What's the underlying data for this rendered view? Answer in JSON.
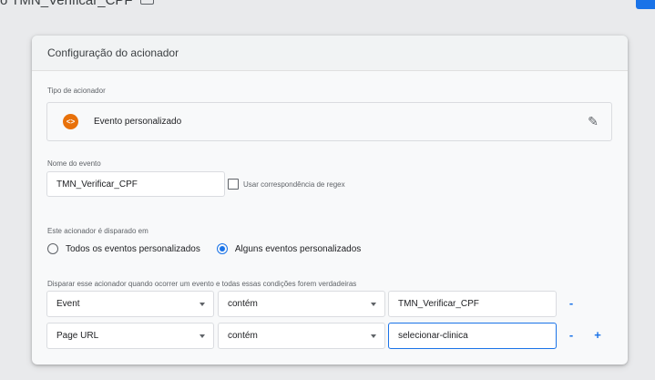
{
  "topbar": {
    "breadcrumb": "o TMN_Verificar_CPF"
  },
  "card": {
    "title": "Configuração do acionador",
    "trigger_type_label": "Tipo de acionador",
    "trigger_type": {
      "icon": "custom-event-icon",
      "icon_glyph": "<>",
      "name": "Evento personalizado",
      "color": "#e8710a"
    },
    "event_name_label": "Nome do evento",
    "event_name_value": "TMN_Verificar_CPF",
    "regex_label": "Usar correspondência de regex",
    "fires_on_label": "Este acionador é disparado em",
    "fires_on_options": [
      {
        "label": "Todos os eventos personalizados",
        "selected": false
      },
      {
        "label": "Alguns eventos personalizados",
        "selected": true
      }
    ],
    "conditions_label": "Disparar esse acionador quando ocorrer um evento e todas essas condições forem verdadeiras",
    "conditions": [
      {
        "variable": "Event",
        "operator": "contém",
        "value": "TMN_Verificar_CPF",
        "remove": "-",
        "add": ""
      },
      {
        "variable": "Page URL",
        "operator": "contém",
        "value": "selecionar-clinica",
        "remove": "-",
        "add": "+"
      }
    ]
  },
  "colors": {
    "accent": "#1a73e8",
    "trigger_icon": "#e8710a"
  }
}
